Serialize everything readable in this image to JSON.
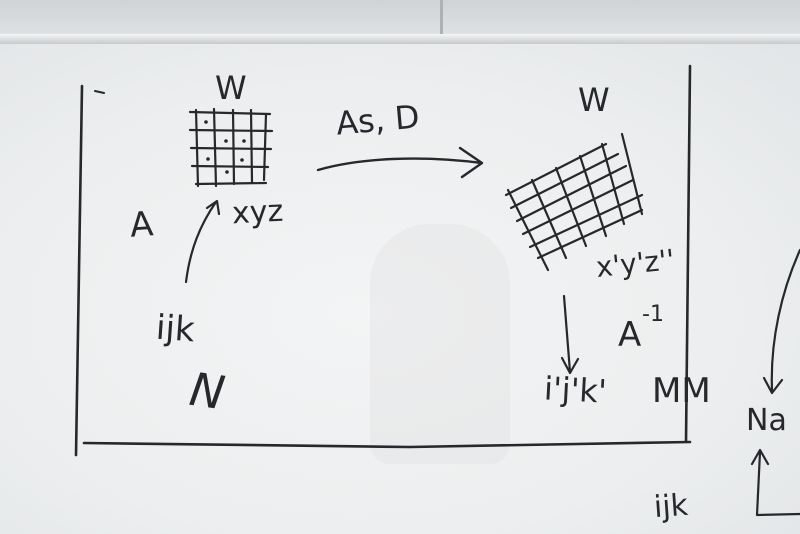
{
  "labels": {
    "w_left": "W",
    "a_left": "A",
    "xyz_left": "xyz",
    "ijk_left": "ijk",
    "n_left": "N",
    "transform": "As, D",
    "w_right": "W",
    "xyz_right": "x'y'z''",
    "a_inverse": "A",
    "inverse_exp": "-1",
    "ijk_right": "i'j'k'",
    "mm": "MM",
    "na_right": "Na",
    "ijk_bottom": "ijk"
  }
}
